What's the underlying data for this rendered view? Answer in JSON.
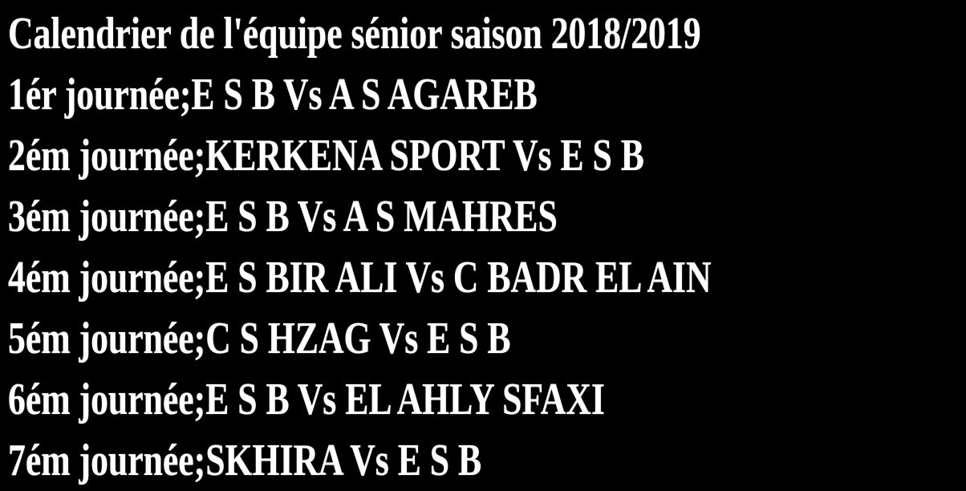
{
  "title": "Calendrier de l'équipe sénior saison 2018/2019",
  "rounds": [
    "1ér journée;E S B Vs A S AGAREB",
    "2ém journée;KERKENA SPORT Vs E S B",
    "3ém journée;E S B Vs A S MAHRES",
    "4ém journée;E S BIR ALI Vs C BADR EL AIN",
    "5ém journée;C S HZAG Vs E S B",
    "6ém journée;E S B Vs EL AHLY SFAXI",
    "7ém journée;SKHIRA Vs E S B"
  ],
  "colors": {
    "background": "#000000",
    "text": "#ffffff"
  }
}
